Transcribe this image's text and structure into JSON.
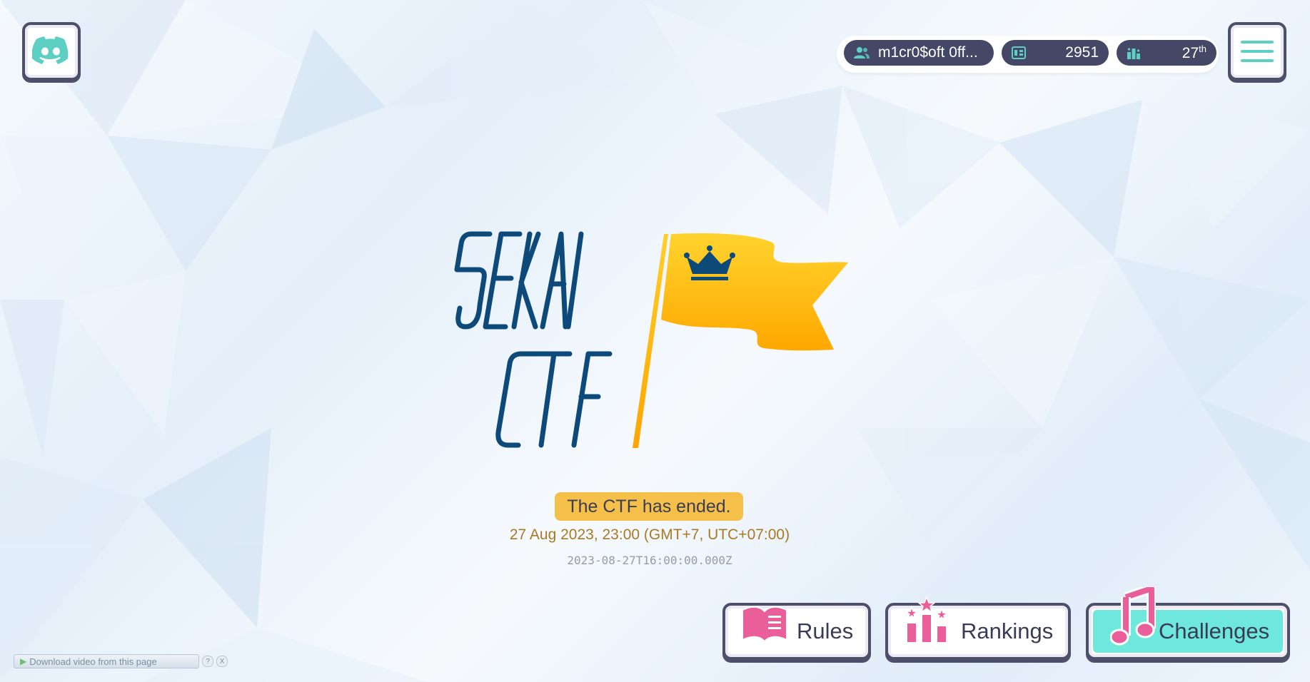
{
  "header": {
    "team_name": "m1cr0$oft 0ff...",
    "score": "2951",
    "rank_number": "27",
    "rank_suffix": "th"
  },
  "status": {
    "ended_message": "The CTF has ended.",
    "end_local": "27 Aug 2023, 23:00 (GMT+7, UTC+07:00)",
    "end_iso": "2023-08-27T16:00:00.000Z"
  },
  "nav": {
    "rules": "Rules",
    "rankings": "Rankings",
    "challenges": "Challenges"
  },
  "extension": {
    "download_label": "Download video from this page",
    "help_label": "?",
    "close_label": "X"
  },
  "colors": {
    "teal_accent": "#5ecfc3",
    "pill_bg": "#444766",
    "logo_blue": "#0d4a7a",
    "flag_yellow": "#ffc21a",
    "ended_badge": "#f5c04a",
    "pink_icon": "#ea5e9a"
  },
  "icons": [
    "discord-icon",
    "hamburger-menu-icon",
    "team-icon",
    "score-icon",
    "rank-icon",
    "book-icon",
    "podium-icon",
    "music-note-icon"
  ]
}
